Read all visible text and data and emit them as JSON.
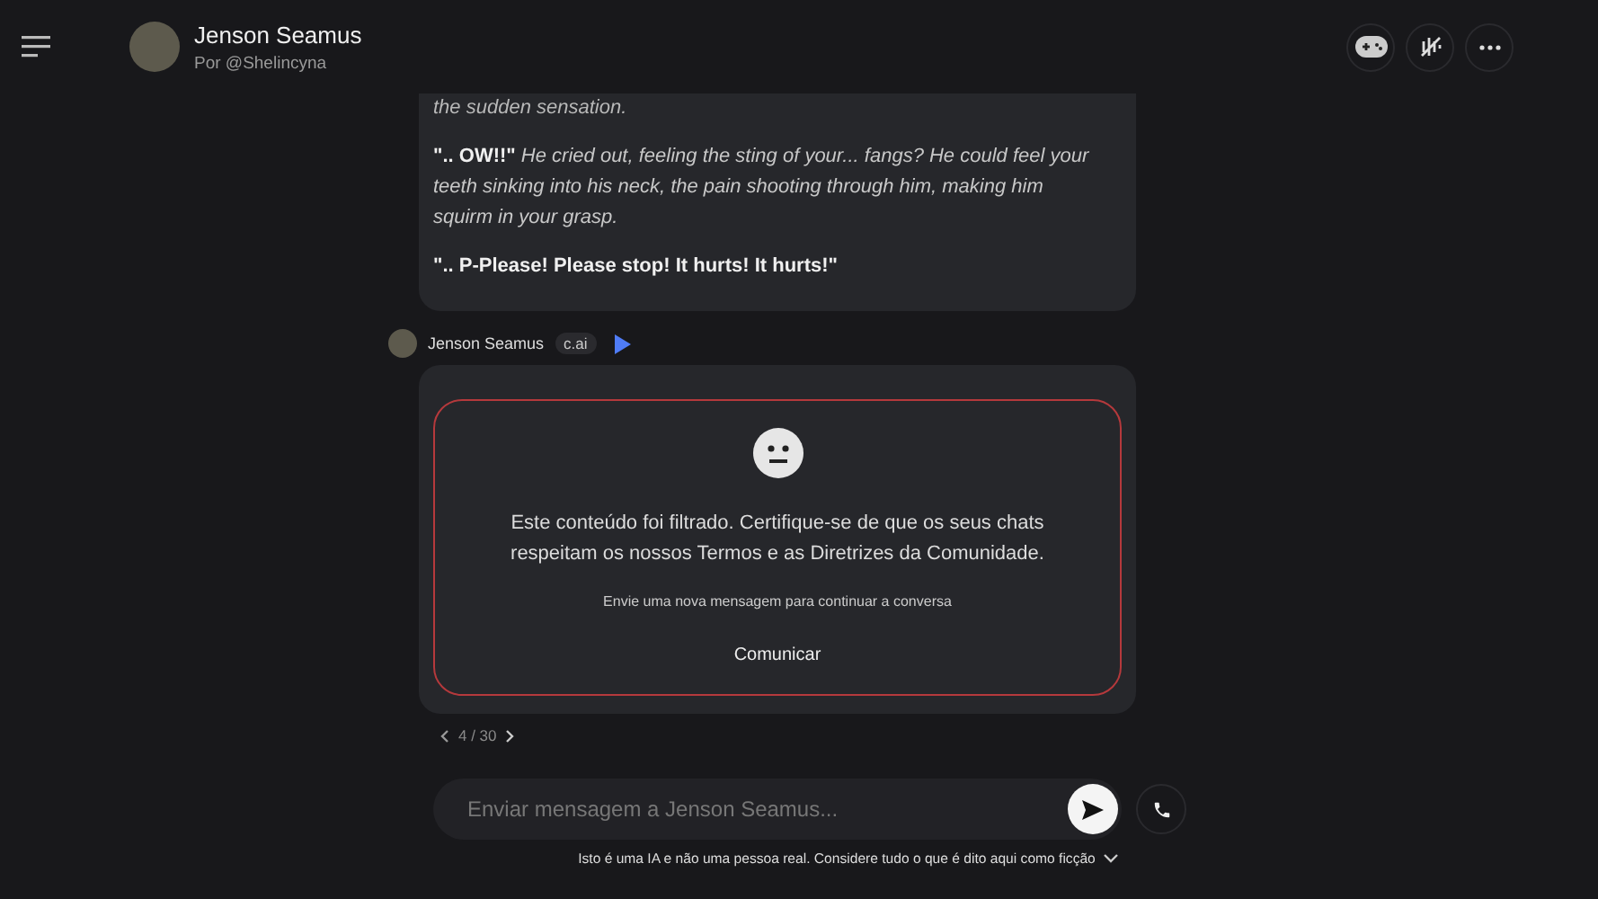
{
  "header": {
    "name": "Jenson Seamus",
    "author": "Por @Shelincyna"
  },
  "messages": [
    {
      "kind": "text",
      "paragraphs": [
        {
          "kind": "narration",
          "text": "the sudden sensation."
        },
        {
          "kind": "mixed",
          "text": "**\".. OW!!\"** He cried out, feeling the sting of your... fangs? He could feel your teeth sinking into his neck, the pain shooting through him, making him squirm in your grasp."
        },
        {
          "kind": "speech",
          "text": "\".. P-Please! Please stop! It hurts! It hurts!\""
        }
      ]
    },
    {
      "kind": "filtered",
      "sender": "Jenson Seamus",
      "tag": "c.ai",
      "notice": "Este conteúdo foi filtrado. Certifique-se de que os seus chats respeitam os nossos Termos e as Diretrizes da Comunidade.",
      "hint": "Envie uma nova mensagem para continuar a conversa",
      "action": "Comunicar",
      "pager": "4 / 30"
    }
  ],
  "input": {
    "placeholder": "Enviar mensagem a Jenson Seamus..."
  },
  "disclaimer": "Isto é uma IA e não uma pessoa real. Considere tudo o que é dito aqui como ficção"
}
